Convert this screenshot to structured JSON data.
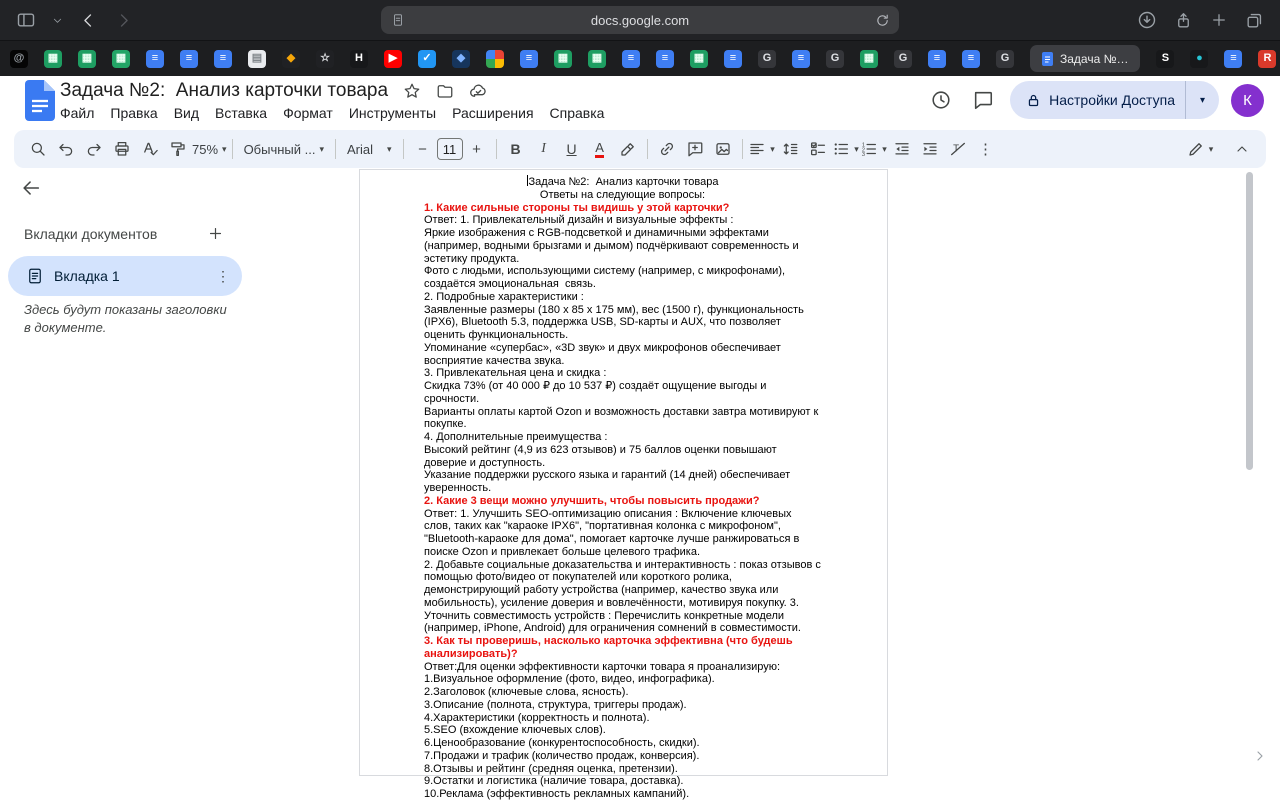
{
  "colors": {
    "heading_red": "#e8130f",
    "toolbar_bg": "#edf2fa",
    "selected_tab_bg": "#d3e3fd",
    "share_button_bg": "#dce3f7",
    "avatar_bg": "#8430ce",
    "docs_blue": "#3a7af2"
  },
  "browser": {
    "url": "docs.google.com",
    "active_tab_label": "Задача №…",
    "pinned_left": [
      {
        "name": "at",
        "bg": "#050505",
        "g": "@",
        "fg": "#9aa0a6"
      },
      {
        "name": "sheets",
        "bg": "#1e9e62",
        "g": "▦",
        "fg": "#eafff3"
      },
      {
        "name": "sheets",
        "bg": "#1e9e62",
        "g": "▦",
        "fg": "#eafff3"
      },
      {
        "name": "sheets",
        "bg": "#23a566",
        "g": "▦",
        "fg": "#eafff3"
      },
      {
        "name": "docs",
        "bg": "#3f7ef3",
        "g": "≡",
        "fg": "#ffffff"
      },
      {
        "name": "docs",
        "bg": "#3f7ef3",
        "g": "≡",
        "fg": "#ffffff"
      },
      {
        "name": "docs",
        "bg": "#3f7ef3",
        "g": "≡",
        "fg": "#ffffff"
      },
      {
        "name": "light",
        "bg": "#e9ebee",
        "g": "▤",
        "fg": "#80868b"
      },
      {
        "name": "orange",
        "bg": "#202124",
        "g": "◆",
        "fg": "#f6a609"
      },
      {
        "name": "star",
        "bg": "#202124",
        "g": "☆",
        "fg": "#e8eaed"
      },
      {
        "name": "h",
        "bg": "#17181a",
        "g": "H",
        "fg": "#ffffff"
      },
      {
        "name": "youtube",
        "bg": "#ff0000",
        "g": "▶",
        "fg": "#ffffff"
      },
      {
        "name": "check-blue",
        "bg": "#2196f3",
        "g": "✓",
        "fg": "#ffffff"
      },
      {
        "name": "navy",
        "bg": "#16355c",
        "g": "◆",
        "fg": "#7fb3ff"
      },
      {
        "name": "google",
        "multi": true
      },
      {
        "name": "docs",
        "bg": "#3f7ef3",
        "g": "≡",
        "fg": "#ffffff"
      },
      {
        "name": "sheets",
        "bg": "#1e9e62",
        "g": "▦",
        "fg": "#eafff3"
      },
      {
        "name": "sheets",
        "bg": "#1e9e62",
        "g": "▦",
        "fg": "#eafff3"
      },
      {
        "name": "docs",
        "bg": "#3f7ef3",
        "g": "≡",
        "fg": "#ffffff"
      },
      {
        "name": "docs",
        "bg": "#3f7ef3",
        "g": "≡",
        "fg": "#ffffff"
      },
      {
        "name": "sheets",
        "bg": "#1e9e62",
        "g": "▦",
        "fg": "#eafff3"
      },
      {
        "name": "docs",
        "bg": "#3f7ef3",
        "g": "≡",
        "fg": "#ffffff"
      },
      {
        "name": "g-gray",
        "bg": "#35363a",
        "g": "G",
        "fg": "#dfe1e5"
      },
      {
        "name": "docs",
        "bg": "#3f7ef3",
        "g": "≡",
        "fg": "#ffffff"
      },
      {
        "name": "g-gray",
        "bg": "#35363a",
        "g": "G",
        "fg": "#dfe1e5"
      },
      {
        "name": "sheets",
        "bg": "#1e9e62",
        "g": "▦",
        "fg": "#eafff3"
      },
      {
        "name": "g-gray",
        "bg": "#35363a",
        "g": "G",
        "fg": "#dfe1e5"
      },
      {
        "name": "docs",
        "bg": "#3f7ef3",
        "g": "≡",
        "fg": "#ffffff"
      },
      {
        "name": "docs",
        "bg": "#3f7ef3",
        "g": "≡",
        "fg": "#ffffff"
      },
      {
        "name": "g-gray",
        "bg": "#35363a",
        "g": "G",
        "fg": "#dfe1e5"
      }
    ],
    "pinned_right": [
      {
        "name": "s",
        "bg": "#17181a",
        "g": "S",
        "fg": "#ffffff"
      },
      {
        "name": "teal",
        "bg": "#17181a",
        "g": "●",
        "fg": "#27c4d4"
      },
      {
        "name": "docs",
        "bg": "#3f7ef3",
        "g": "≡",
        "fg": "#ffffff"
      },
      {
        "name": "r-red",
        "bg": "#d93a2b",
        "g": "R",
        "fg": "#ffffff"
      }
    ]
  },
  "docs": {
    "title": "Задача №2:  Анализ карточки товара",
    "menus": [
      "Файл",
      "Правка",
      "Вид",
      "Вставка",
      "Формат",
      "Инструменты",
      "Расширения",
      "Справка"
    ],
    "share_label": "Настройки Доступа",
    "avatar": "К"
  },
  "toolbar": {
    "zoom": "75%",
    "style": "Обычный ...",
    "font": "Arial",
    "size": "11"
  },
  "tabs_panel": {
    "title": "Вкладки документов",
    "tab": "Вкладка 1",
    "hint": "Здесь будут показаны заголовки в документе."
  },
  "icon_names": {
    "titlebar": [
      "sidebar-toggle-icon",
      "chevron-down-icon",
      "back-icon",
      "forward-icon",
      "page-icon",
      "reload-icon",
      "download-icon",
      "share-icon",
      "new-tab-icon",
      "tabs-overview-icon"
    ],
    "header": [
      "docs-logo",
      "star-icon",
      "move-folder-icon",
      "cloud-status-icon",
      "version-history-icon",
      "comments-icon",
      "lock-icon",
      "dropdown-icon"
    ],
    "toolbar": [
      "search-icon",
      "undo-icon",
      "redo-icon",
      "print-icon",
      "spellcheck-icon",
      "paint-format-icon",
      "bold-icon",
      "italic-icon",
      "underline-icon",
      "text-color-icon",
      "highlight-icon",
      "insert-link-icon",
      "add-comment-icon",
      "insert-image-icon",
      "align-icon",
      "line-spacing-icon",
      "checklist-icon",
      "bulleted-list-icon",
      "numbered-list-icon",
      "decrease-indent-icon",
      "increase-indent-icon",
      "clear-formatting-icon",
      "more-icon",
      "editing-mode-icon",
      "collapse-icon"
    ]
  },
  "document": {
    "paragraphs": [
      {
        "t": "Задача №2:  Анализ карточки товара",
        "center": true,
        "caret": true
      },
      {
        "t": "Ответы на следующие вопросы:",
        "center": true
      },
      {
        "t": "1. Какие сильные стороны ты видишь у этой карточки?",
        "red": true
      },
      {
        "t": "Ответ: 1. Привлекательный дизайн и визуальные эффекты :"
      },
      {
        "t": "Яркие изображения с RGB-подсветкой и динамичными эффектами (например, водными брызгами и дымом) подчёркивают современность и эстетику продукта."
      },
      {
        "t": "Фото с людьми, использующими систему (например, с микрофонами), создаётся эмоциональная  связь."
      },
      {
        "t": "2. Подробные характеристики :"
      },
      {
        "t": "Заявленные размеры (180 x 85 x 175 мм), вес (1500 г), функциональность (IPX6), Bluetooth 5.3, поддержка USB, SD-карты и AUX, что позволяет оценить функциональность."
      },
      {
        "t": "Упоминание «супербас», «3D звук» и двух микрофонов обеспечивает восприятие качества звука."
      },
      {
        "t": "3. Привлекательная цена и скидка :"
      },
      {
        "t": "Скидка 73% (от 40 000 ₽ до 10 537 ₽) создаёт ощущение выгоды и срочности."
      },
      {
        "t": "Варианты оплаты картой Ozon и возможность доставки завтра мотивируют к покупке."
      },
      {
        "t": "4. Дополнительные преимущества :"
      },
      {
        "t": "Высокий рейтинг (4,9 из 623 отзывов) и 75 баллов оценки повышают доверие и доступность."
      },
      {
        "t": "Указание поддержки русского языка и гарантий (14 дней) обеспечивает уверенность."
      },
      {
        "t": "2. Какие 3 вещи можно улучшить, чтобы повысить продажи?",
        "red": true
      },
      {
        "t": "Ответ: 1. Улучшить SEO-оптимизацию описания : Включение ключевых слов, таких как \"караоке IPX6\", \"портативная колонка с микрофоном\", \"Bluetooth-караоке для дома\", помогает карточке лучше ранжироваться в поиске Ozon и привлекает больше целевого трафика."
      },
      {
        "t": "2. Добавьте социальные доказательства и интерактивность : показ отзывов с помощью фото/видео от покупателей или короткого ролика, демонстрирующий работу устройства (например, качество звука или мобильность), усиление доверия и вовлечённости, мотивируя покупку. 3. Уточнить совместимость устройств : Перечислить конкретные модели (например, iPhone, Android) для ограничения сомнений в совместимости."
      },
      {
        "t": "3. Как ты проверишь, насколько карточка эффективна (что будешь анализировать)?",
        "red": true
      },
      {
        "t": "Ответ:Для оценки эффективности карточки товара я проанализирую:"
      },
      {
        "t": "1.Визуальное оформление (фото, видео, инфографика)."
      },
      {
        "t": "2.Заголовок (ключевые слова, ясность)."
      },
      {
        "t": "3.Описание (полнота, структура, триггеры продаж)."
      },
      {
        "t": "4.Характеристики (корректность и полнота)."
      },
      {
        "t": "5.SEO (вхождение ключевых слов)."
      },
      {
        "t": "6.Ценообразование (конкурентоспособность, скидки)."
      },
      {
        "t": "7.Продажи и трафик (количество продаж, конверсия)."
      },
      {
        "t": "8.Отзывы и рейтинг (средняя оценка, претензии)."
      },
      {
        "t": "9.Остатки и логистика (наличие товара, доставка)."
      },
      {
        "t": "10.Реклама (эффективность рекламных кампаний)."
      }
    ]
  }
}
